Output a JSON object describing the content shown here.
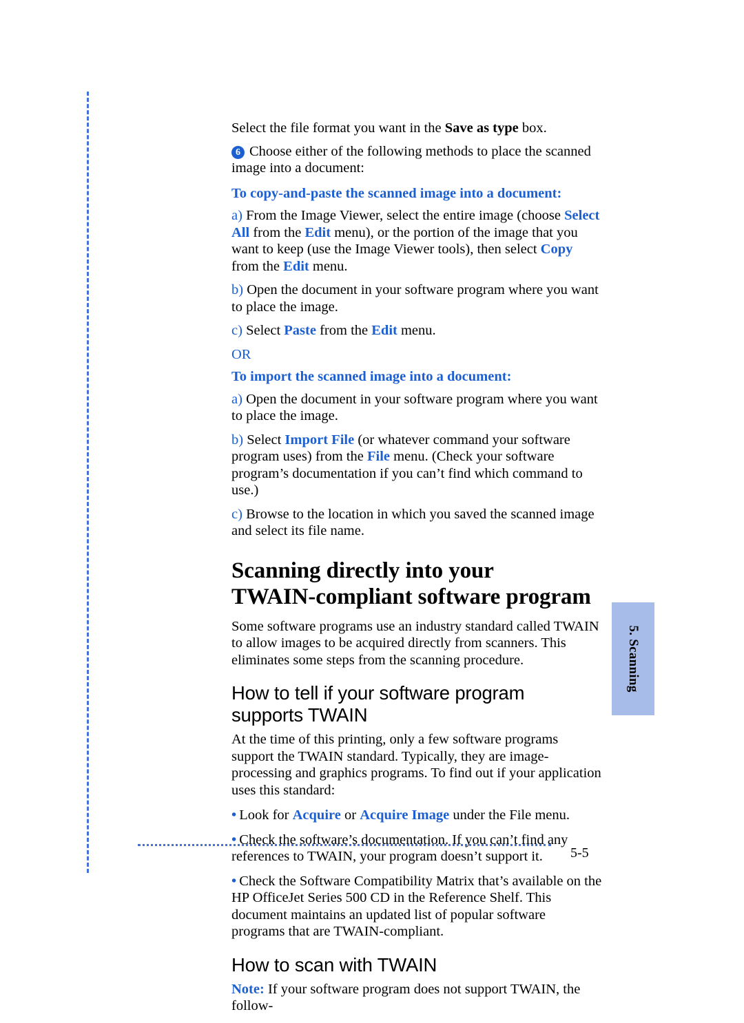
{
  "document": {
    "page_number": "5-5",
    "side_tab_label": "5. Scanning",
    "accent_blue": "#1b5fd0",
    "tab_blue": "#a7bce8",
    "rule_blue": "#4472d8"
  },
  "intro": {
    "line_a": "Select the file format you want in the ",
    "line_a_bold": "Save as type",
    "line_a_end": " box."
  },
  "step6": {
    "badge": "6",
    "text": "Choose either of the following methods to place the scanned image into a document:"
  },
  "copy_paste": {
    "heading": "To copy-and-paste the scanned image into a document:",
    "steps": [
      {
        "marker": "a)",
        "part1": " From the Image Viewer, select the entire image (choose ",
        "em1": "Select All",
        "part2": " from the ",
        "em2": "Edit",
        "part3": " menu), or the portion of the image that you want to keep (use the Image Viewer tools), then select ",
        "em3": "Copy",
        "part4": " from the ",
        "em4": "Edit",
        "part5": " menu."
      },
      {
        "marker": "b)",
        "part1": " Open the document in your software program where you want to place the image."
      },
      {
        "marker": "c)",
        "part1": " Select ",
        "em1": "Paste",
        "part2": " from the ",
        "em2": "Edit",
        "part3": " menu."
      }
    ]
  },
  "or_divider": "OR",
  "import": {
    "heading": "To import the scanned image into a document:",
    "steps": [
      {
        "marker": "a)",
        "part1": " Open the document in your software program where you want to place the image."
      },
      {
        "marker": "b)",
        "part1": " Select ",
        "em1": "Import File",
        "part2": " (or whatever command your software program uses) from the ",
        "em2": "File",
        "part3": " menu. (Check your software program’s documentation if you can’t find which command to use.)"
      },
      {
        "marker": "c)",
        "part1": " Browse to the location in which you saved the scanned image and select its file name."
      }
    ]
  },
  "section": {
    "title_line1": "Scanning directly into your",
    "title_line2": "TWAIN-compliant software program",
    "intro_paragraph": "Some software programs use an industry standard called TWAIN to allow images to be acquired directly from scanners. This eliminates some steps from the scanning procedure."
  },
  "how_to_tell": {
    "heading_line1": "How to tell if your software program",
    "heading_line2": "supports TWAIN",
    "paragraph": "At the time of this printing, only a few software programs support the TWAIN standard. Typically, they are image-processing and graphics programs. To find out if your application uses this standard:",
    "bullets": [
      {
        "part1": "Look for ",
        "em1": "Acquire",
        "part2": " or ",
        "em2": "Acquire Image",
        "part3": " under the File menu."
      },
      {
        "part1": "Check the software’s documentation. If you can’t find any references to TWAIN, your program doesn’t support it."
      },
      {
        "part1": "Check the Software Compatibility Matrix that’s available on the HP OfficeJet Series 500 CD in the Reference Shelf. This document maintains an updated list of popular software programs that are TWAIN-compliant."
      }
    ]
  },
  "how_to_scan": {
    "heading": "How to scan with TWAIN",
    "note_label": "Note:",
    "note_text": " If your software program does not support TWAIN, the follow-"
  }
}
